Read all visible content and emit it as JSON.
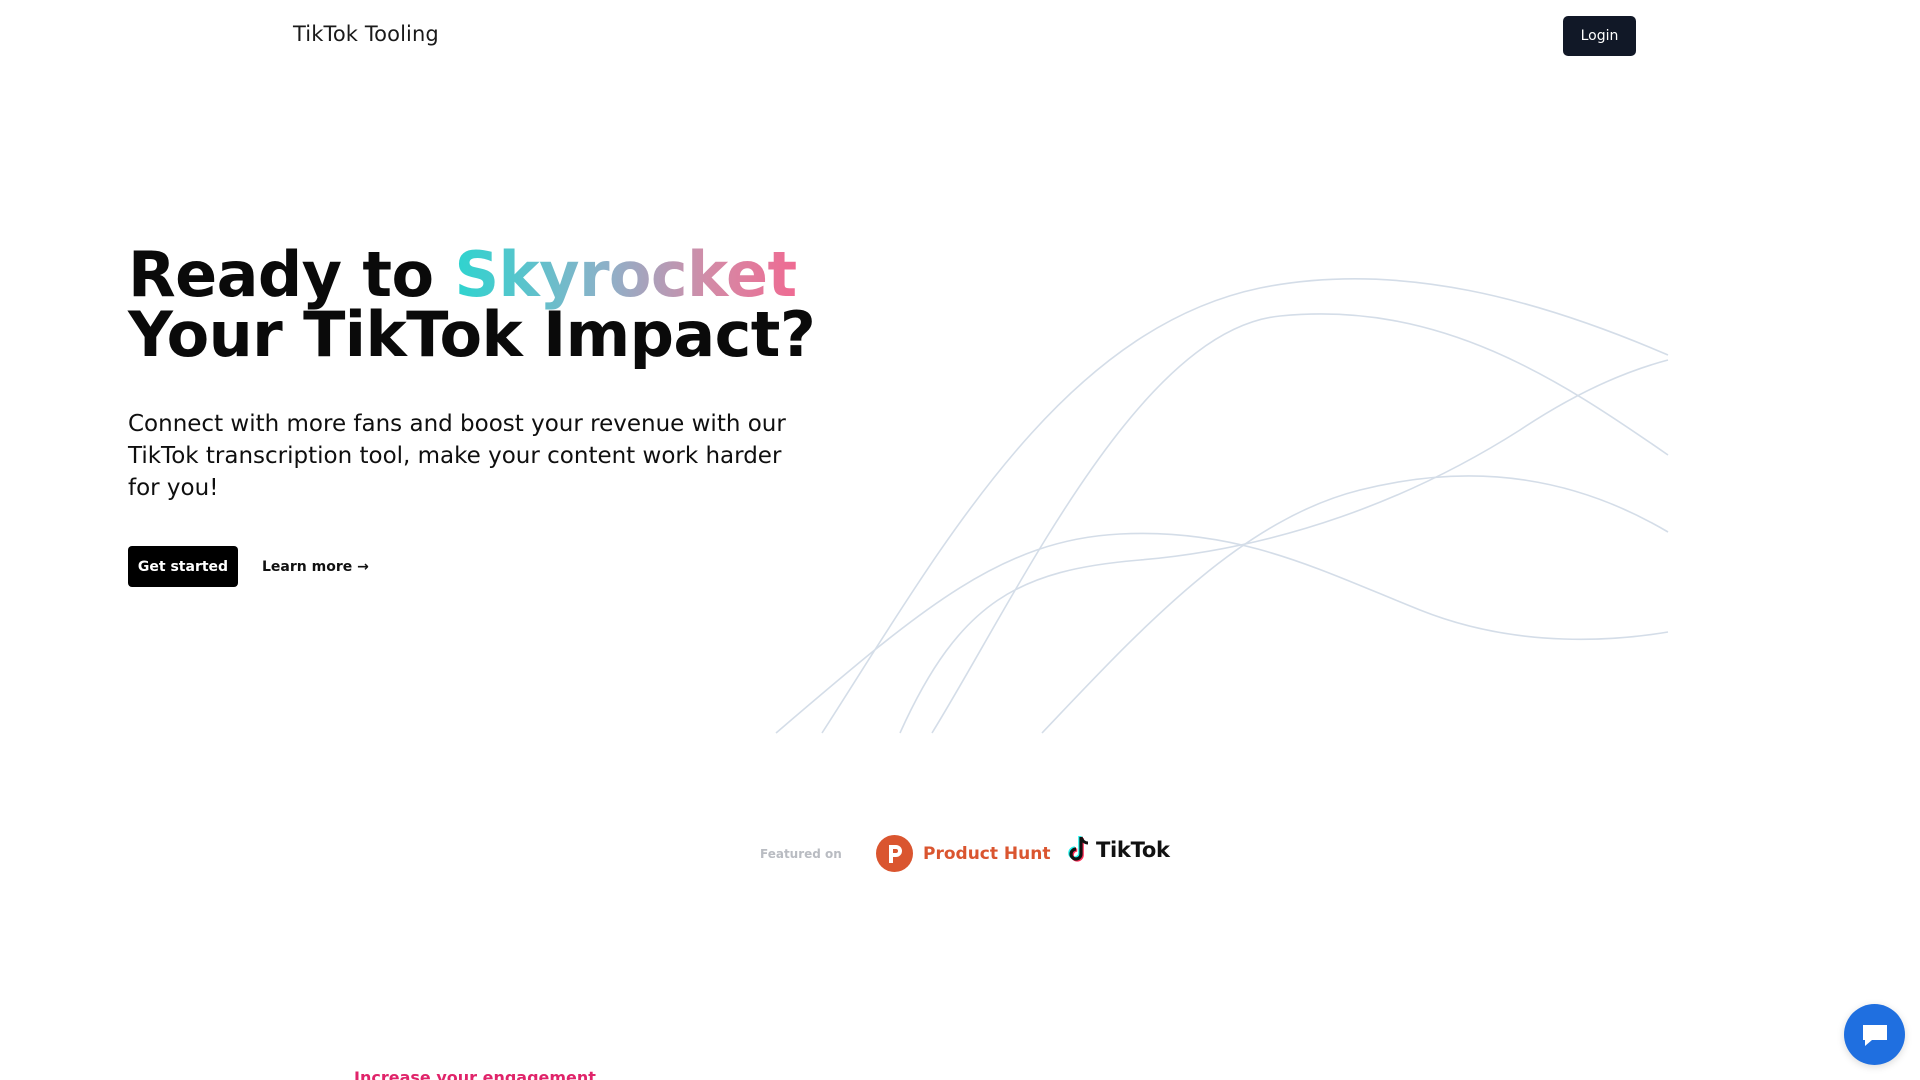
{
  "header": {
    "brand": "TikTok Tooling",
    "login_label": "Login"
  },
  "hero": {
    "title_prefix": "Ready to ",
    "title_accent": "Skyrocket",
    "title_line2": "Your TikTok Impact?",
    "subtitle": "Connect with more fans and boost your revenue with our TikTok transcription tool, make your content work harder for you!",
    "primary_cta": "Get started",
    "secondary_cta": "Learn more →"
  },
  "featured": {
    "label": "Featured on",
    "logos": [
      {
        "name": "Product Hunt",
        "icon": "product-hunt-icon",
        "color": "#da552f"
      },
      {
        "name": "TikTok",
        "icon": "tiktok-icon"
      }
    ]
  },
  "section_teaser": "Increase your engagement",
  "chat": {
    "icon": "chat-icon",
    "color": "#1f6fe0"
  },
  "colors": {
    "login_bg": "#111827",
    "cta_bg": "#000000",
    "accent_gradient": [
      "#2dd4cf",
      "#8fb0c8",
      "#d48aa6",
      "#ef6a92"
    ],
    "teaser": "#e0246a"
  }
}
